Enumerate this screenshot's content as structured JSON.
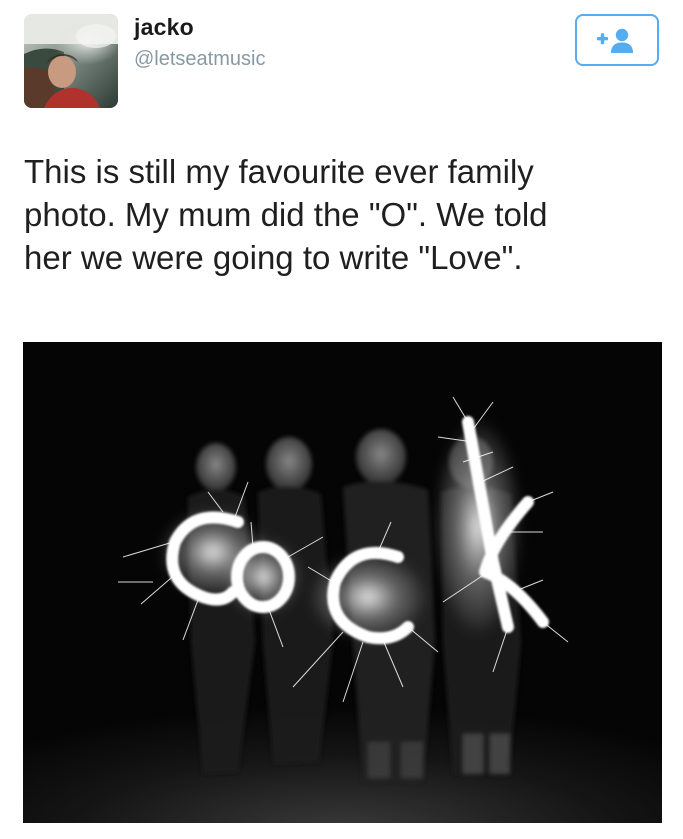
{
  "tweet": {
    "author": {
      "display_name": "jacko",
      "handle": "@letseatmusic",
      "avatar_icon": "profile-photo"
    },
    "follow_button": {
      "icon": "add-user-icon",
      "accent_color": "#55acee"
    },
    "text_lines": [
      "This is still my favourite ever family",
      "photo. My mum did the \"O\". We told",
      "her we were going to write \"Love\"."
    ],
    "photo": {
      "description_icon": "sparkler-family-photo",
      "sparkler_text": "cock",
      "people_count": 4
    }
  }
}
